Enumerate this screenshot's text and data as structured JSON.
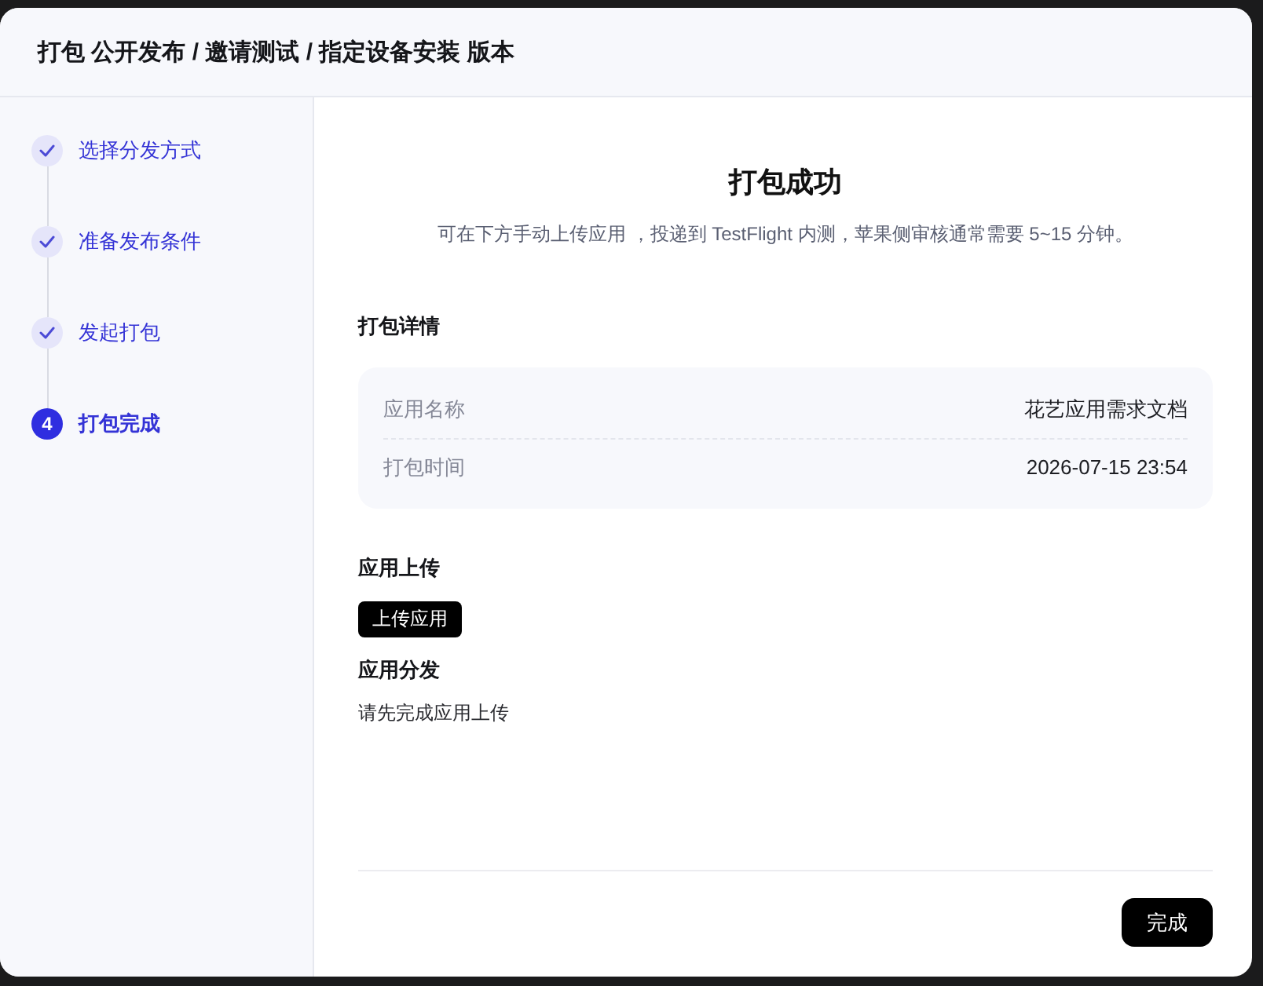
{
  "dialog": {
    "title": "打包 公开发布 / 邀请测试 / 指定设备安装 版本"
  },
  "steps": [
    {
      "label": "选择分发方式",
      "completed": true,
      "selected": false
    },
    {
      "label": "准备发布条件",
      "completed": true,
      "selected": false
    },
    {
      "label": "发起打包",
      "completed": true,
      "selected": false
    },
    {
      "label": "打包完成",
      "completed": false,
      "selected": true,
      "number": "4"
    }
  ],
  "result": {
    "title": "打包成功",
    "description": "可在下方手动上传应用 ，投递到 TestFlight 内测，苹果侧审核通常需要 5~15 分钟。"
  },
  "details": {
    "heading": "打包详情",
    "rows": [
      {
        "label": "应用名称",
        "value": "花艺应用需求文档"
      },
      {
        "label": "打包时间",
        "value": "2026-07-15 23:54"
      }
    ]
  },
  "upload": {
    "heading": "应用上传",
    "button": "上传应用"
  },
  "distribution": {
    "heading": "应用分发",
    "message": "请先完成应用上传"
  },
  "footer": {
    "button": "完成"
  }
}
